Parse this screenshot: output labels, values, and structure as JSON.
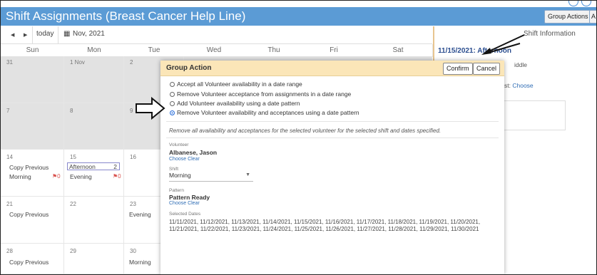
{
  "app": {
    "title": "Shift Assignments (Breast Cancer Help Line)",
    "group_actions_label": "Group Actions",
    "extra_btn_label": "A"
  },
  "toolbar": {
    "prev": "◀",
    "next": "▶",
    "today": "today",
    "calendar_icon": "▦",
    "month": "Nov, 2021"
  },
  "calendar": {
    "weekdays": [
      "Sun",
      "Mon",
      "Tue",
      "Wed",
      "Thu",
      "Fri",
      "Sat"
    ],
    "rows": [
      {
        "dates": [
          "31",
          "1 Nov",
          "2"
        ]
      },
      {
        "dates": [
          "7",
          "8",
          "9"
        ]
      },
      {
        "dates": [
          "14",
          "15",
          "16"
        ]
      },
      {
        "dates": [
          "21",
          "22",
          "23"
        ]
      },
      {
        "dates": [
          "28",
          "29",
          "30"
        ]
      }
    ],
    "row14": {
      "sun_line1": "Copy Previous",
      "sun_line2": "Morning",
      "sun_flag": "⚑0",
      "mon_box": "Afternoon",
      "mon_box_count": "2",
      "mon_line2": "Evening",
      "mon_flag": "⚑0"
    },
    "row21": {
      "sun_line1": "Copy Previous",
      "tue_line": "Evening"
    },
    "row28": {
      "sun_line1": "Copy Previous",
      "tue_line": "Morning"
    }
  },
  "right_panel": {
    "title": "Shift Information",
    "date": "11/15/2021: Afternoon",
    "line1": "iddle",
    "line2_prefix": "st:",
    "line2_link": "Choose"
  },
  "modal": {
    "title": "Group Action",
    "confirm": "Confirm",
    "cancel": "Cancel",
    "options": [
      {
        "label": "Accept all Volunteer availability in a date range",
        "selected": false
      },
      {
        "label": "Remove Volunteer acceptance from assignments in a date range",
        "selected": false
      },
      {
        "label": "Add Volunteer availability using a date pattern",
        "selected": false
      },
      {
        "label": "Remove Volunteer availability and acceptances using a date pattern",
        "selected": true
      }
    ],
    "description": "Remove all availability and acceptances for the selected volunteer for the selected shift and dates specified.",
    "volunteer_label": "Volunteer",
    "volunteer_value": "Albanese, Jason",
    "volunteer_links": "Choose  Clear",
    "shift_label": "Shift",
    "shift_value": "Morning",
    "pattern_label": "Pattern",
    "pattern_value": "Pattern Ready",
    "pattern_links": "Choose  Clear",
    "dates_label": "Selected Dates",
    "dates_line1": "11/11/2021, 11/12/2021, 11/13/2021, 11/14/2021, 11/15/2021, 11/16/2021, 11/17/2021, 11/18/2021, 11/19/2021, 11/20/2021,",
    "dates_line2": "11/21/2021, 11/22/2021, 11/23/2021, 11/24/2021, 11/25/2021, 11/26/2021, 11/27/2021, 11/28/2021, 11/29/2021, 11/30/2021"
  },
  "colors": {
    "header": "#5b9bd5",
    "modal_header": "#fbe6b8",
    "link": "#2f6db5",
    "radio_selected": "#2a6fdb"
  },
  "icons": {
    "annotation_arrow_right": "outlined-arrow-icon",
    "annotation_arrow_black": "pointer-arrow-icon"
  }
}
